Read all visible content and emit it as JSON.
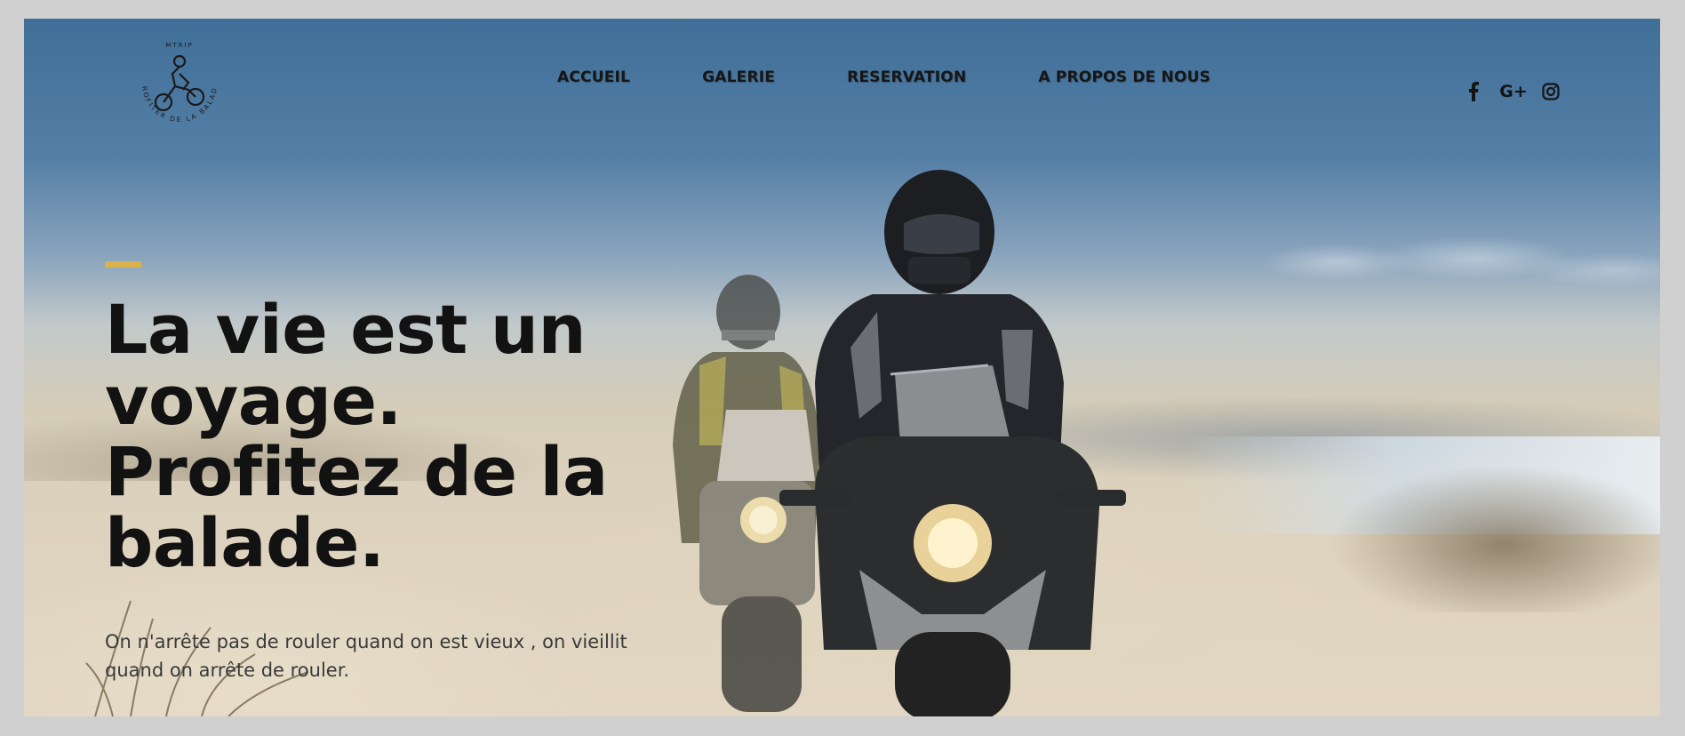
{
  "brand": {
    "logo_text_top": "MTRIP",
    "logo_text_ring": "PROFITER DE LA BALADE"
  },
  "nav": {
    "items": [
      {
        "label": "ACCUEIL"
      },
      {
        "label": "GALERIE"
      },
      {
        "label": "RESERVATION"
      },
      {
        "label": "A PROPOS DE NOUS"
      }
    ]
  },
  "social": {
    "icons": [
      "facebook-icon",
      "google-plus-icon",
      "instagram-icon"
    ],
    "gplus_glyph": "G+"
  },
  "hero": {
    "headline_lines": [
      "La vie est un",
      "voyage.",
      "Profitez de la",
      "balade."
    ],
    "subtitle_line1": "On n'arrête pas de rouler quand on est vieux , on vieillit",
    "subtitle_line2": "quand on arrête de rouler."
  },
  "colors": {
    "accent": "#d8b24a",
    "text_dark": "#121212",
    "sky_top": "#3f6f98",
    "dust": "#ddd2bd",
    "frame_border": "#d0d0d0"
  }
}
